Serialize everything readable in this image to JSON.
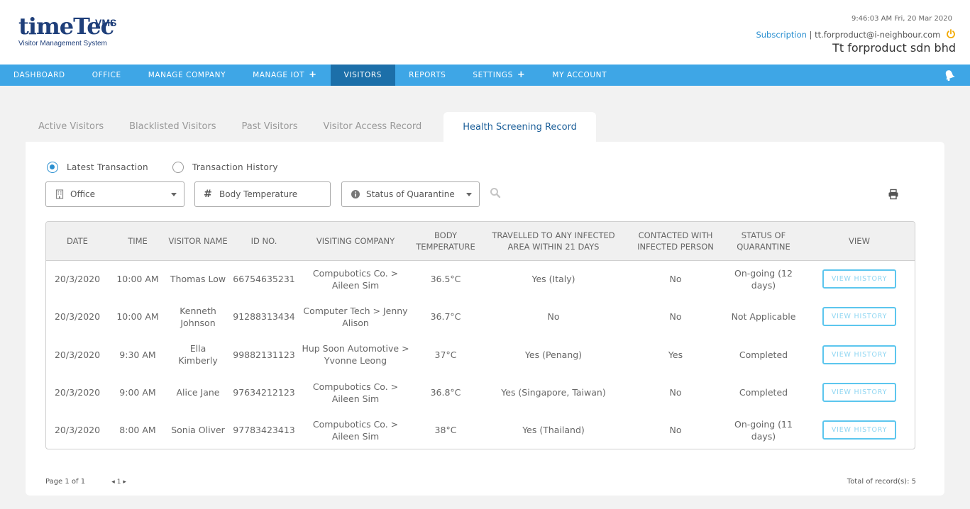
{
  "header": {
    "logo_main": "timeTec",
    "logo_badge": "VMS",
    "logo_subtitle": "Visitor Management System",
    "datetime": "9:46:03 AM  Fri, 20 Mar 2020",
    "subscription_link": "Subscription",
    "separator": "|",
    "email": "tt.forproduct@i-neighbour.com",
    "company_name": "Tt forproduct sdn bhd"
  },
  "nav": {
    "items": [
      {
        "label": "DASHBOARD"
      },
      {
        "label": "OFFICE"
      },
      {
        "label": "MANAGE COMPANY"
      },
      {
        "label": "MANAGE IOT",
        "plus": "+"
      },
      {
        "label": "VISITORS"
      },
      {
        "label": "REPORTS"
      },
      {
        "label": "SETTINGS",
        "plus": "+"
      },
      {
        "label": "MY ACCOUNT"
      }
    ],
    "active": "VISITORS"
  },
  "tabs": [
    {
      "label": "Active Visitors"
    },
    {
      "label": "Blacklisted Visitors"
    },
    {
      "label": "Past Visitors"
    },
    {
      "label": "Visitor Access Record"
    },
    {
      "label": "Health Screening Record"
    }
  ],
  "radios": {
    "latest": "Latest Transaction",
    "history": "Transaction History",
    "selected": "Latest Transaction"
  },
  "filters": {
    "office": "Office",
    "temperature_placeholder": "Body Temperature",
    "status": "Status of Quarantine"
  },
  "table": {
    "columns": [
      "DATE",
      "TIME",
      "VISITOR NAME",
      "ID NO.",
      "VISITING COMPANY",
      "BODY TEMPERATURE",
      "TRAVELLED TO ANY INFECTED AREA WITHIN 21 DAYS",
      "CONTACTED WITH INFECTED PERSON",
      "STATUS OF QUARANTINE",
      "VIEW"
    ],
    "rows": [
      {
        "date": "20/3/2020",
        "time": "10:00 AM",
        "name": "Thomas Low",
        "id": "66754635231",
        "company": "Compubotics Co. > Aileen Sim",
        "temp": "36.5°C",
        "travelled": "Yes (Italy)",
        "contacted": "No",
        "status": "On-going (12 days)",
        "view": "VIEW HISTORY"
      },
      {
        "date": "20/3/2020",
        "time": "10:00 AM",
        "name": "Kenneth Johnson",
        "id": "91288313434",
        "company": "Computer Tech > Jenny Alison",
        "temp": "36.7°C",
        "travelled": "No",
        "contacted": "No",
        "status": "Not Applicable",
        "view": "VIEW HISTORY"
      },
      {
        "date": "20/3/2020",
        "time": "9:30 AM",
        "name": "Ella Kimberly",
        "id": "99882131123",
        "company": "Hup Soon Automotive > Yvonne Leong",
        "temp": "37°C",
        "travelled": "Yes (Penang)",
        "contacted": "Yes",
        "status": "Completed",
        "view": "VIEW HISTORY"
      },
      {
        "date": "20/3/2020",
        "time": "9:00 AM",
        "name": "Alice Jane",
        "id": "97634212123",
        "company": "Compubotics Co. > Aileen Sim",
        "temp": "36.8°C",
        "travelled": "Yes (Singapore, Taiwan)",
        "contacted": "No",
        "status": "Completed",
        "view": "VIEW HISTORY"
      },
      {
        "date": "20/3/2020",
        "time": "8:00 AM",
        "name": "Sonia Oliver",
        "id": "97783423413",
        "company": "Compubotics Co. > Aileen Sim",
        "temp": "38°C",
        "travelled": "Yes (Thailand)",
        "contacted": "No",
        "status": "On-going (11 days)",
        "view": "VIEW HISTORY"
      }
    ]
  },
  "footer": {
    "page_info": "Page 1 of 1",
    "pager_prev": "◂",
    "pager_current": "1",
    "pager_next": "▸",
    "total": "Total of record(s): 5"
  },
  "colors": {
    "nav_bg": "#3ea6e6",
    "nav_active": "#1c6fa9",
    "accent": "#2a8fd0",
    "power_icon": "#f2a900"
  }
}
